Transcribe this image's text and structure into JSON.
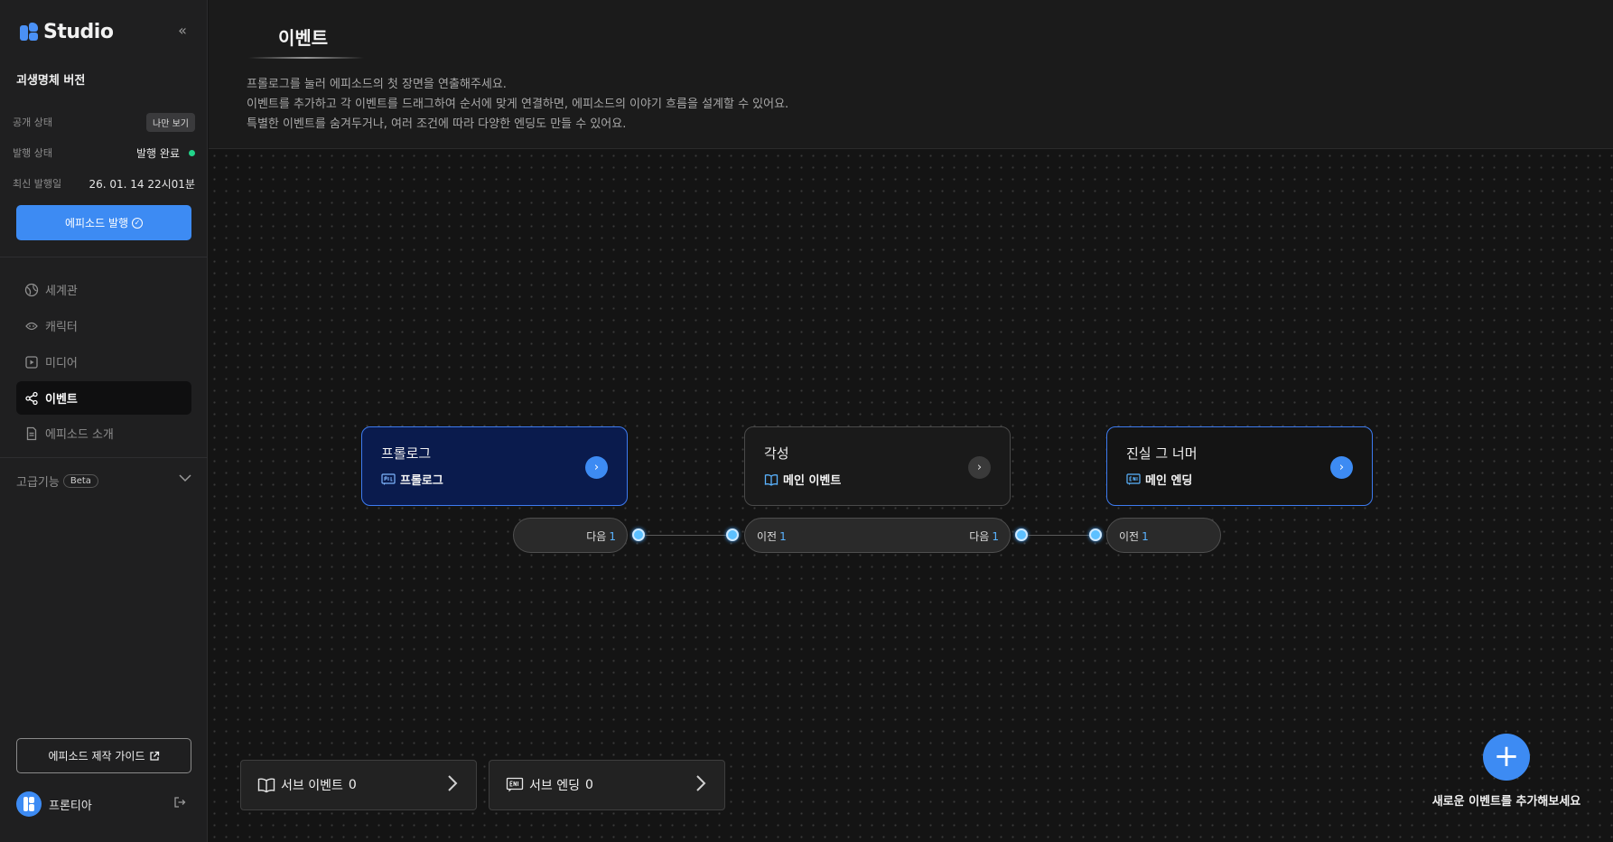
{
  "app": {
    "name": "Studio",
    "collapse_icon": "double-chevron-left-icon"
  },
  "sidebar": {
    "episode_name": "괴생명체 버전",
    "visibility": {
      "label": "공개 상태",
      "value": "나만 보기"
    },
    "publish_status": {
      "label": "발행 상태",
      "value": "발행 완료",
      "status_color": "#22d48a"
    },
    "last_published": {
      "label": "최신 발행일",
      "value": "26. 01. 14 22시01분"
    },
    "publish_button": "에피소드 발행",
    "nav": [
      {
        "label": "세계관",
        "icon": "globe-icon",
        "active": false
      },
      {
        "label": "캐릭터",
        "icon": "character-face-icon",
        "active": false
      },
      {
        "label": "미디어",
        "icon": "play-square-icon",
        "active": false
      },
      {
        "label": "이벤트",
        "icon": "share-nodes-icon",
        "active": true
      },
      {
        "label": "에피소드 소개",
        "icon": "document-icon",
        "active": false
      }
    ],
    "advanced": {
      "label": "고급기능",
      "badge": "Beta"
    },
    "guide_button": "에피소드 제작 가이드",
    "user": {
      "name": "프론티아"
    }
  },
  "header": {
    "title": "이벤트",
    "description": [
      "프롤로그를 눌러 에피소드의 첫 장면을 연출해주세요.",
      "이벤트를 추가하고 각 이벤트를 드래그하여 순서에 맞게 연결하면, 에피소드의 이야기 흐름을 설계할 수 있어요.",
      "특별한 이벤트를 숨겨두거나, 여러 조건에 따라 다양한 엔딩도 만들 수 있어요."
    ]
  },
  "nodes": [
    {
      "title": "프롤로그",
      "type": "프롤로그",
      "type_icon": "prologue-tag-icon",
      "next_label": "다음",
      "next_count": "1"
    },
    {
      "title": "각성",
      "type": "메인 이벤트",
      "type_icon": "book-icon",
      "prev_label": "이전",
      "prev_count": "1",
      "next_label": "다음",
      "next_count": "1"
    },
    {
      "title": "진실 그 너머",
      "type": "메인 엔딩",
      "type_icon": "ending-tag-icon",
      "prev_label": "이전",
      "prev_count": "1"
    }
  ],
  "sub_cards": [
    {
      "label": "서브 이벤트",
      "count": "0",
      "icon": "book-icon"
    },
    {
      "label": "서브 엔딩",
      "count": "0",
      "icon": "ending-tag-icon"
    }
  ],
  "add_event": {
    "hint": "새로운 이벤트를 추가해보세요",
    "icon": "plus-icon"
  },
  "colors": {
    "accent": "#3d8bf3",
    "prologue_bg": "#0a1b4d",
    "port": "#5cc0ff"
  }
}
